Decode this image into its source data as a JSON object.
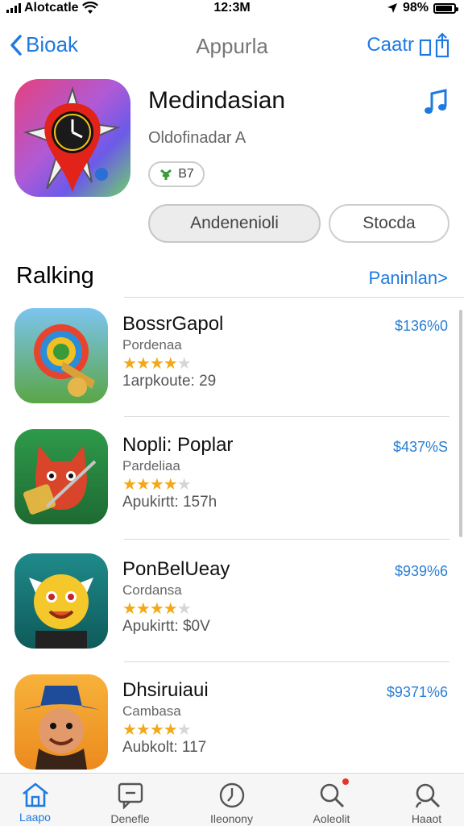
{
  "status_bar": {
    "carrier": "Alotcatle",
    "time": "12:3M",
    "battery": "98%",
    "battery_level": 0.9
  },
  "nav": {
    "back_label": "Bioak",
    "title": "Appurla",
    "right_label": "Caatr"
  },
  "app": {
    "name": "Medindasian",
    "developer": "Oldofinadar A",
    "age_rating": "B7",
    "primary_button": "Andenenioli",
    "secondary_button": "Stocda"
  },
  "section": {
    "title": "Ralking",
    "link": "Paninlan>"
  },
  "ranking": [
    {
      "name": "BossrGapol",
      "subtitle": "Pordenaa",
      "rating": 4.5,
      "stars_filled": "★★★★",
      "stars_empty": "★",
      "meta": "1arpkoute: 29",
      "price": "$136%0"
    },
    {
      "name": "Nopli: Poplar",
      "subtitle": "Pardeliaa",
      "rating": 4.5,
      "stars_filled": "★★★★",
      "stars_empty": "★",
      "meta": "Apukirtt: 157h",
      "price": "$437%S"
    },
    {
      "name": "PonBelUeay",
      "subtitle": "Cordansa",
      "rating": 4.5,
      "stars_filled": "★★★★",
      "stars_empty": "★",
      "meta": "Apukirtt: $0V",
      "price": "$939%6"
    },
    {
      "name": "Dhsiruiaui",
      "subtitle": "Cambasa",
      "rating": 4.5,
      "stars_filled": "★★★★",
      "stars_empty": "★",
      "meta": "Aubkolt: 117",
      "price": "$9371%6"
    }
  ],
  "tabs": [
    {
      "label": "Laapo",
      "icon": "home-icon",
      "active": true
    },
    {
      "label": "Denefle",
      "icon": "message-icon",
      "active": false
    },
    {
      "label": "Ileonony",
      "icon": "clock-icon",
      "active": false
    },
    {
      "label": "Aoleolit",
      "icon": "search-icon",
      "active": false
    },
    {
      "label": "Haaot",
      "icon": "profile-search-icon",
      "active": false
    }
  ],
  "colors": {
    "accent": "#1f7ae0",
    "star": "#f3a817",
    "price": "#2a7fd4"
  }
}
